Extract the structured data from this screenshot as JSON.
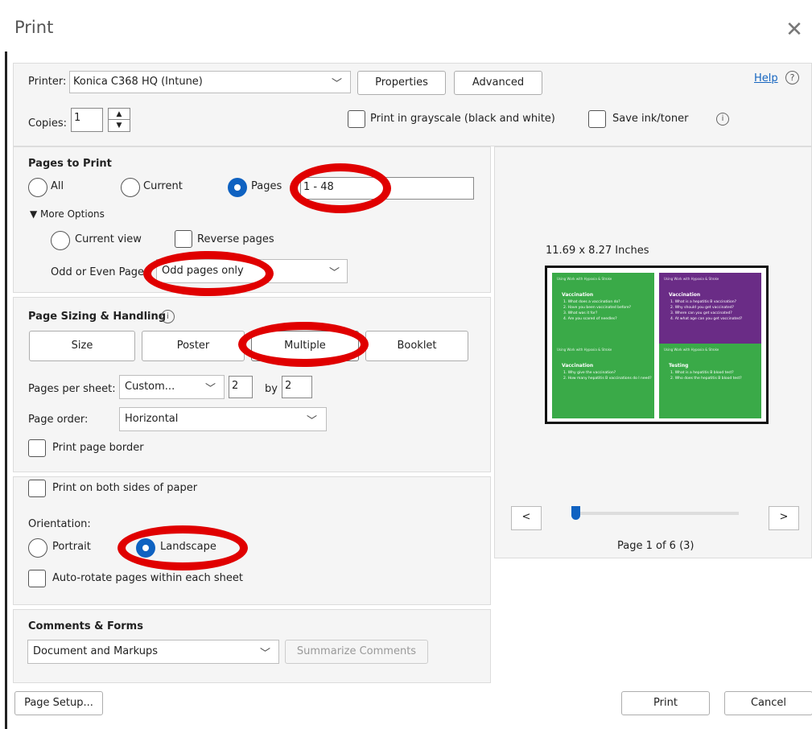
{
  "dialog": {
    "title": "Print",
    "close_icon": "close-icon"
  },
  "printer": {
    "label": "Printer:",
    "value": "Konica C368 HQ (Intune)",
    "properties": "Properties",
    "advanced": "Advanced",
    "help": "Help"
  },
  "copies": {
    "label": "Copies:",
    "value": "1"
  },
  "options": {
    "grayscale": "Print in grayscale (black and white)",
    "save_ink": "Save ink/toner"
  },
  "pages_to_print": {
    "heading": "Pages to Print",
    "all": "All",
    "current": "Current",
    "pages": "Pages",
    "pages_value": "1 - 48",
    "more_options": "More Options",
    "current_view": "Current view",
    "reverse": "Reverse pages",
    "odd_even_label": "Odd or Even Pages",
    "odd_even_value": "Odd pages only"
  },
  "sizing": {
    "heading": "Page Sizing & Handling",
    "tabs": [
      "Size",
      "Poster",
      "Multiple",
      "Booklet"
    ],
    "pps_label": "Pages per sheet:",
    "pps_value": "Custom...",
    "cols": "2",
    "by": "by",
    "rows": "2",
    "order_label": "Page order:",
    "order_value": "Horizontal",
    "border": "Print page border"
  },
  "duplex": {
    "both_sides": "Print on both sides of paper",
    "orientation_label": "Orientation:",
    "portrait": "Portrait",
    "landscape": "Landscape",
    "autorotate": "Auto-rotate pages within each sheet"
  },
  "comments": {
    "heading": "Comments & Forms",
    "value": "Document and Markups",
    "summarize": "Summarize Comments"
  },
  "preview": {
    "size": "11.69 x 8.27 Inches",
    "page_status": "Page 1 of 6 (3)",
    "prev": "<",
    "next": ">",
    "slider_position": 0,
    "colors": {
      "green": "#3aaa48",
      "purple": "#6a2c86"
    },
    "cards": [
      {
        "tag": "Using Work with Hypoxia & Stroke",
        "heading": "Vaccination",
        "lines": [
          "1. What does a vaccination do?",
          "2. Have you been vaccinated before?",
          "3. What was it for?",
          "4. Are you scared of needles?"
        ]
      },
      {
        "tag": "Using Work with Hypoxia & Stroke",
        "heading": "Vaccination",
        "lines": [
          "1. What is a hepatitis B vaccination?",
          "2. Why should you get vaccinated?",
          "3. Where can you get vaccinated?",
          "4. At what age can you get vaccinated?"
        ]
      },
      {
        "tag": "Using Work with Hypoxia & Stroke",
        "heading": "Vaccination",
        "lines": [
          "1. Why give the vaccination?",
          "2. How many hepatitis B vaccinations do I need?"
        ]
      },
      {
        "tag": "Using Work with Hypoxia & Stroke",
        "heading": "Testing",
        "lines": [
          "1. What is a hepatitis B blood test?",
          "2. Who does the hepatitis B blood test?"
        ]
      }
    ]
  },
  "footer": {
    "page_setup": "Page Setup...",
    "print": "Print",
    "cancel": "Cancel"
  }
}
